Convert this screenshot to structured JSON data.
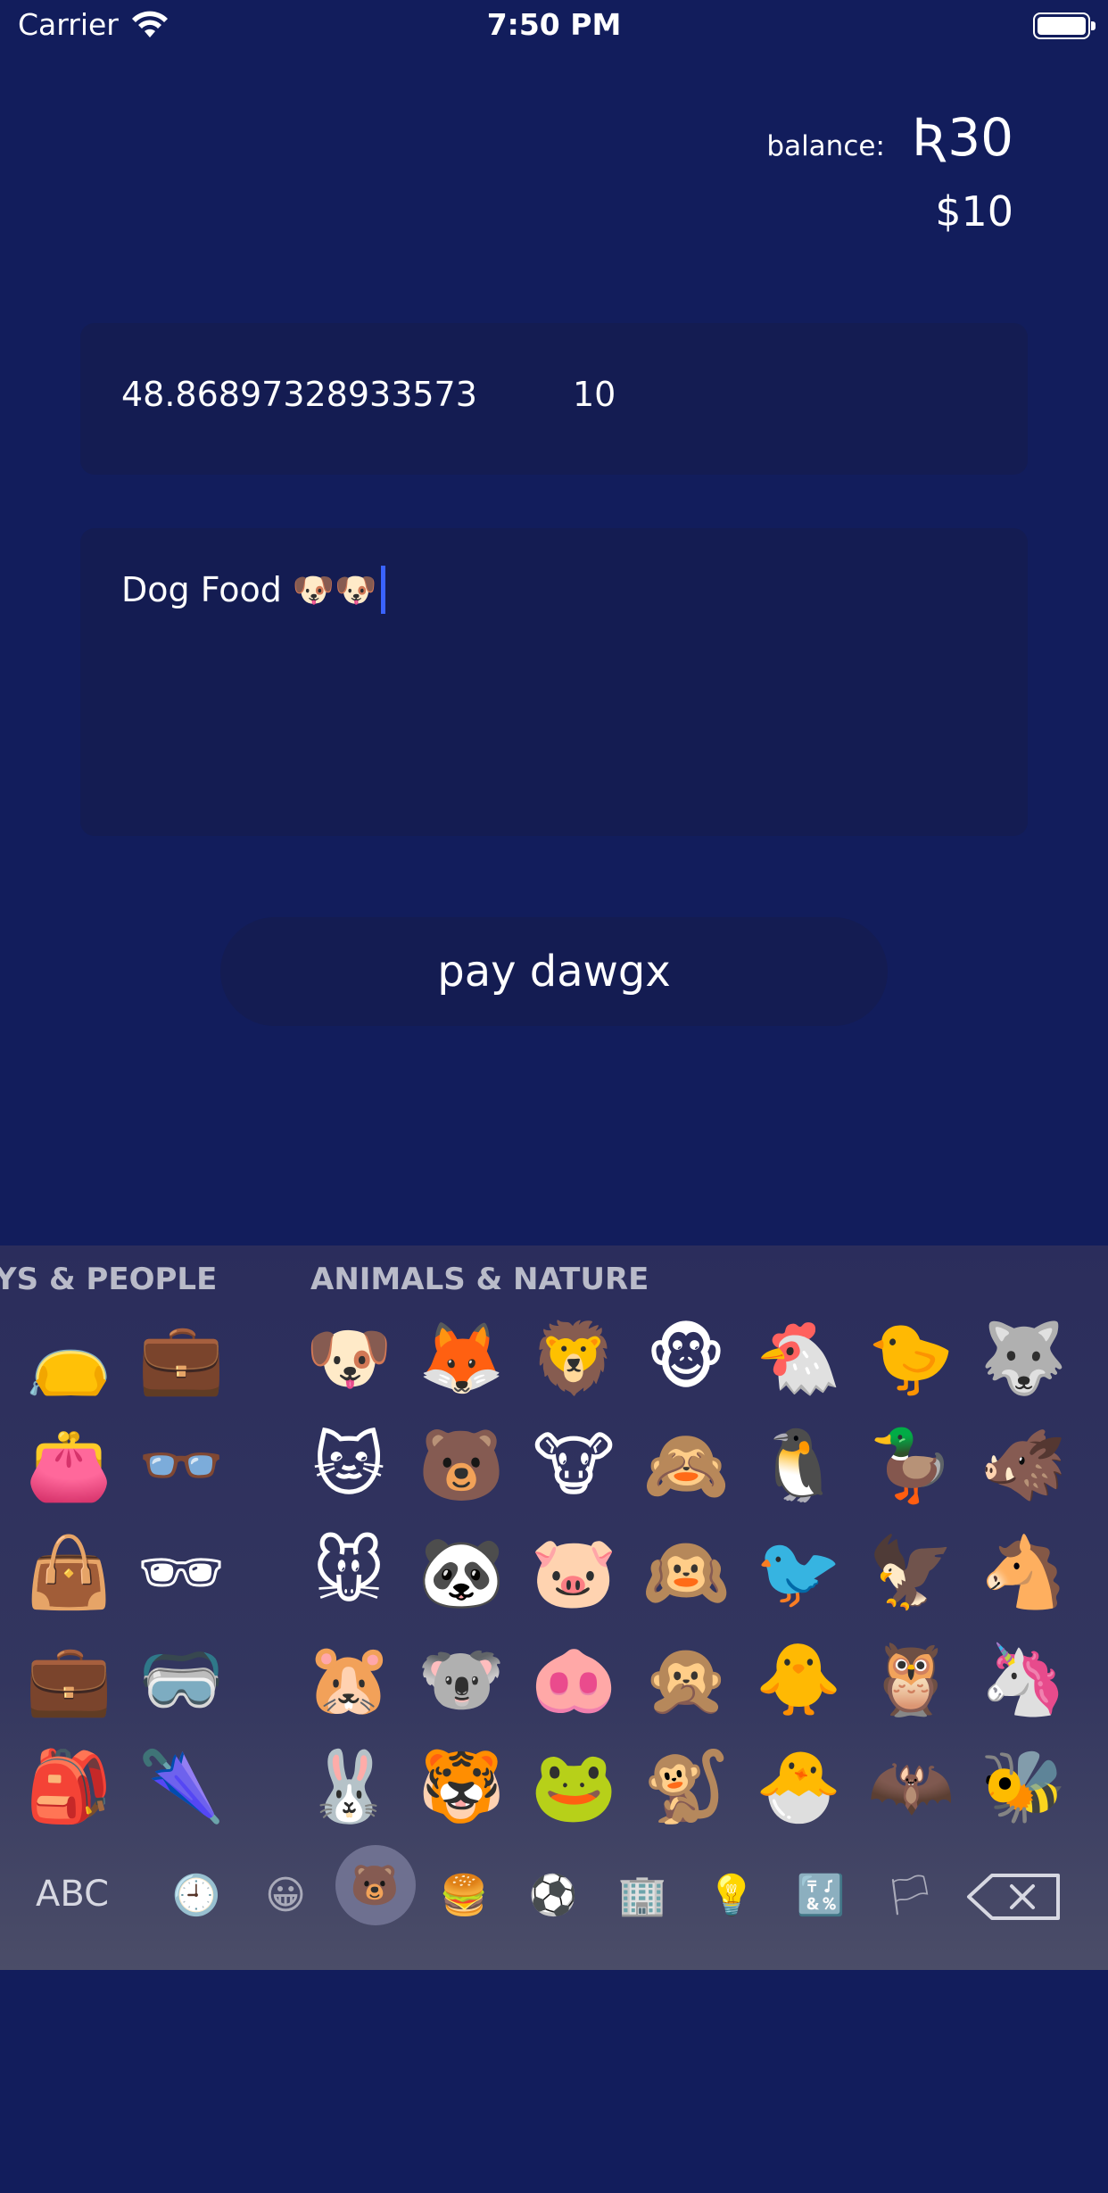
{
  "status_bar": {
    "carrier": "Carrier",
    "time": "7:50 PM"
  },
  "balance": {
    "label": "balance:",
    "amount": "Ʀ30",
    "usd": "$10"
  },
  "amount_field": {
    "left_value": "48.86897328933573",
    "right_value": "10"
  },
  "memo_field": {
    "text": "Dog Food 🐶🐶"
  },
  "pay_button": {
    "label": "pay dawgx"
  },
  "keyboard": {
    "categories": [
      "YS & PEOPLE",
      "ANIMALS & NATURE"
    ],
    "people_column": [
      "👝",
      "💼",
      "👛",
      "👓",
      "👜",
      "🕶",
      "💼",
      "🥽",
      "🎒",
      "🌂"
    ],
    "animals_rows": [
      [
        "🐶",
        "🦊",
        "🦁",
        "🐵",
        "🐔",
        "🐤",
        "🐺"
      ],
      [
        "🐱",
        "🐻",
        "🐮",
        "🙈",
        "🐧",
        "🦆",
        "🐗"
      ],
      [
        "🐭",
        "🐼",
        "🐷",
        "🙉",
        "🐦",
        "🦅",
        "🐴"
      ],
      [
        "🐹",
        "🐨",
        "🐽",
        "🙊",
        "🐥",
        "🦉",
        "🦄"
      ],
      [
        "🐰",
        "🐯",
        "🐸",
        "🐒",
        "🐣",
        "🦇",
        "🐝"
      ]
    ],
    "toolbar": {
      "abc_label": "ABC",
      "icons": [
        "recent-icon",
        "smiley-icon",
        "animal-icon",
        "food-icon",
        "activity-icon",
        "travel-icon",
        "objects-icon",
        "symbols-icon",
        "flags-icon"
      ],
      "glyphs": [
        "🕘",
        "😀",
        "🐻",
        "🍔",
        "⚽",
        "🏢",
        "💡",
        "🔣",
        "🏳"
      ]
    }
  }
}
